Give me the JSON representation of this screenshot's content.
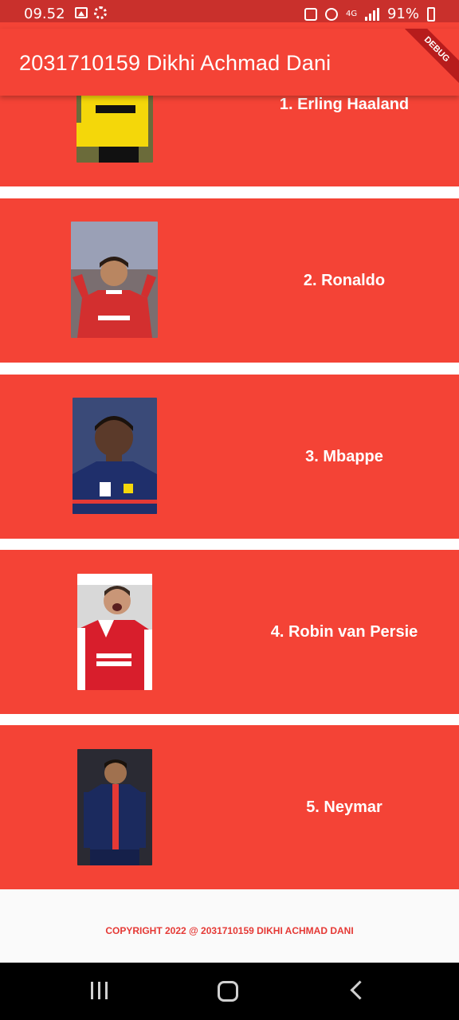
{
  "status_bar": {
    "time": "09.52",
    "network": "4G",
    "battery": "91%",
    "icons": [
      "gallery-icon",
      "sync-icon",
      "lock-icon",
      "alarm-icon",
      "signal-icon",
      "battery-charging-icon"
    ]
  },
  "app_bar": {
    "title": "2031710159 Dikhi Achmad Dani",
    "debug_banner": "DEBUG"
  },
  "players": [
    {
      "name": "1. Erling Haaland",
      "kit_colors": [
        "#f4d70a",
        "#111111"
      ]
    },
    {
      "name": "2. Ronaldo",
      "kit_colors": [
        "#d32f2f",
        "#ffffff"
      ]
    },
    {
      "name": "3. Mbappe",
      "kit_colors": [
        "#1f2f6b",
        "#ffffff"
      ]
    },
    {
      "name": "4. Robin van Persie",
      "kit_colors": [
        "#d81e2c",
        "#ffffff"
      ]
    },
    {
      "name": "5. Neymar",
      "kit_colors": [
        "#1b2a5e",
        "#e53935"
      ]
    }
  ],
  "footer": {
    "copyright": "COPYRIGHT 2022 @ 2031710159 DIKHI ACHMAD DANI"
  },
  "colors": {
    "primary": "#f44336",
    "status_bar": "#c9302c",
    "footer_text": "#e53935"
  }
}
